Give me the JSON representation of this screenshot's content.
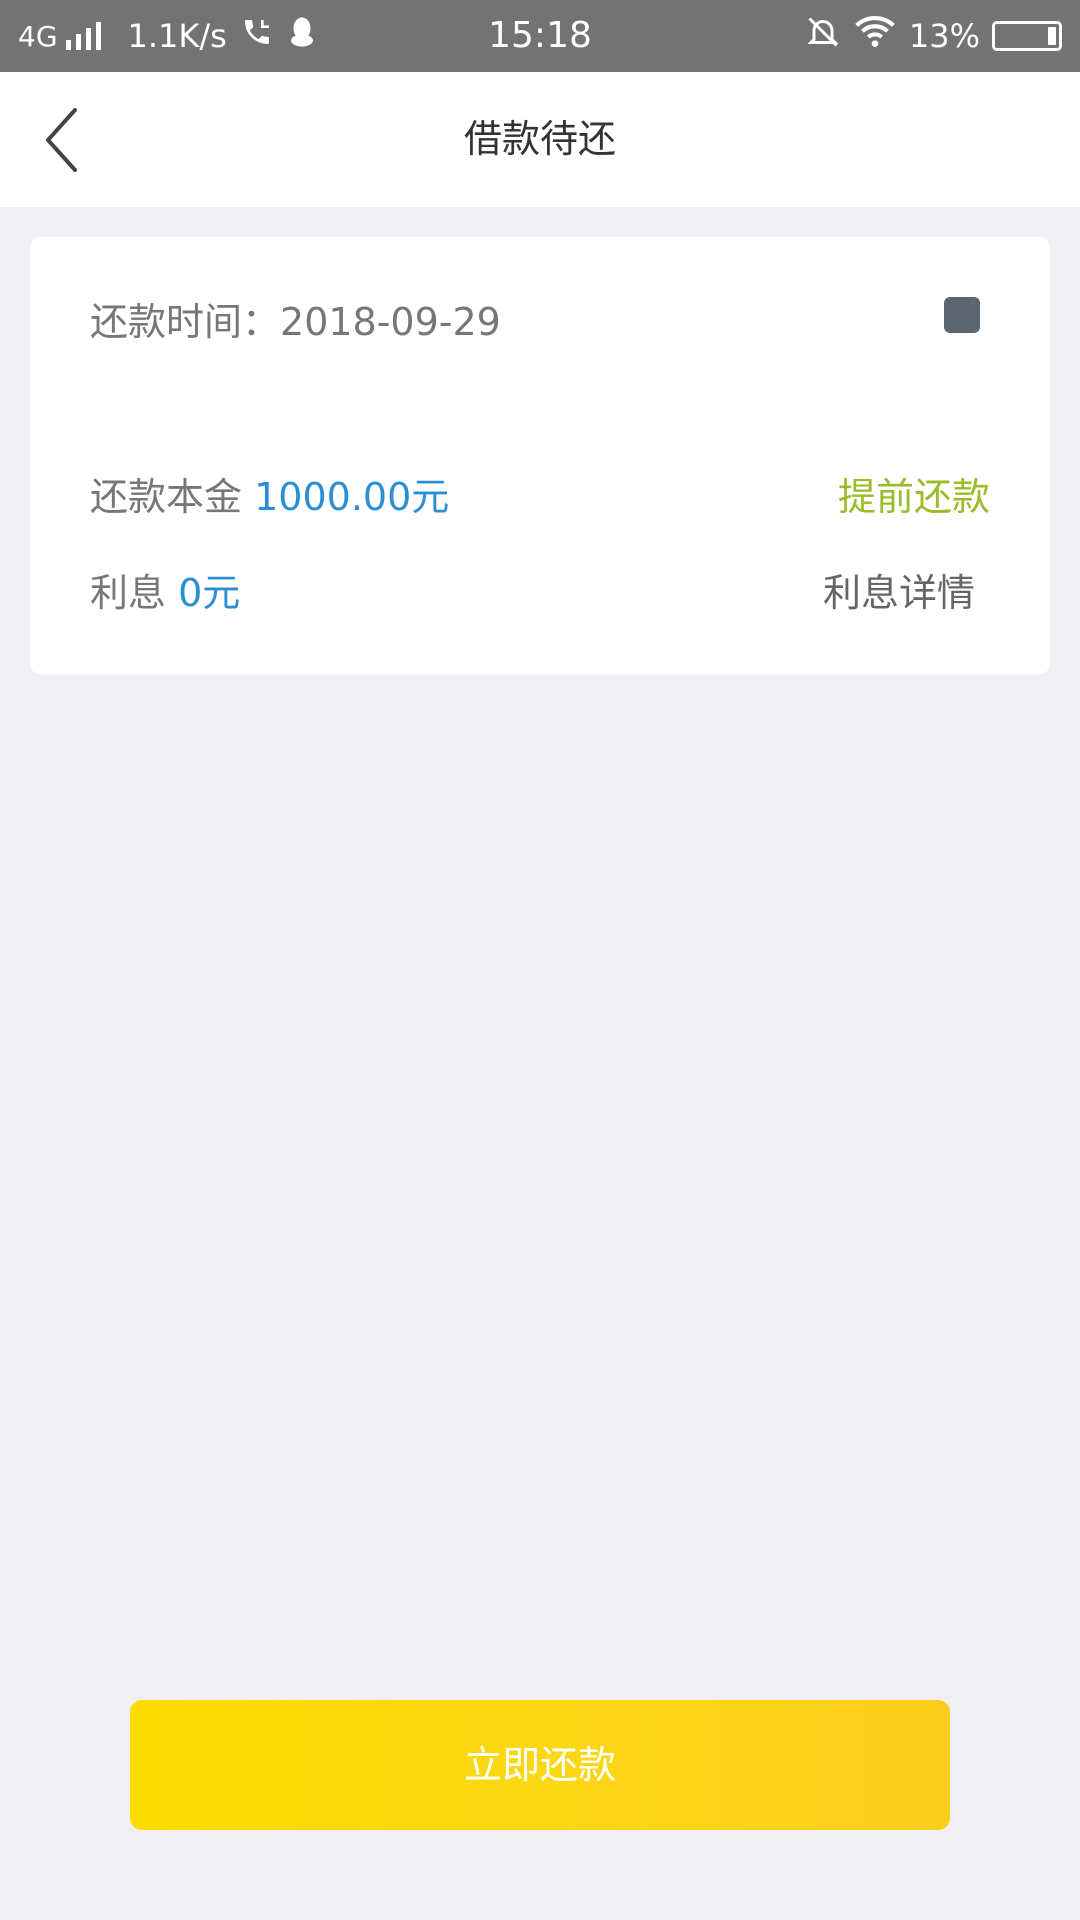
{
  "status_bar": {
    "network": "4G",
    "speed": "1.1K/s",
    "time": "15:18",
    "battery": "13%",
    "battery_level": 0.13,
    "icons": [
      "signal-icon",
      "phone-icon",
      "qq-penguin-icon",
      "bell-off-icon",
      "wifi-icon",
      "battery-icon"
    ]
  },
  "header": {
    "title": "借款待还",
    "back_icon": "chevron-left-icon"
  },
  "card": {
    "date_label": "还款时间：",
    "date_value": "2018-09-29",
    "principal_label": "还款本金",
    "principal_value": "1000.00元",
    "prepay_link": "提前还款",
    "interest_label": "利息",
    "interest_value": "0元",
    "interest_detail_link": "利息详情"
  },
  "pay_button": {
    "label": "立即还款"
  },
  "colors": {
    "status_bar": "#737373",
    "background": "#efeff4",
    "accent_blue": "#2b8fd6",
    "prepay_green": "#9cbb29",
    "button_yellow": "#fbdd00"
  }
}
